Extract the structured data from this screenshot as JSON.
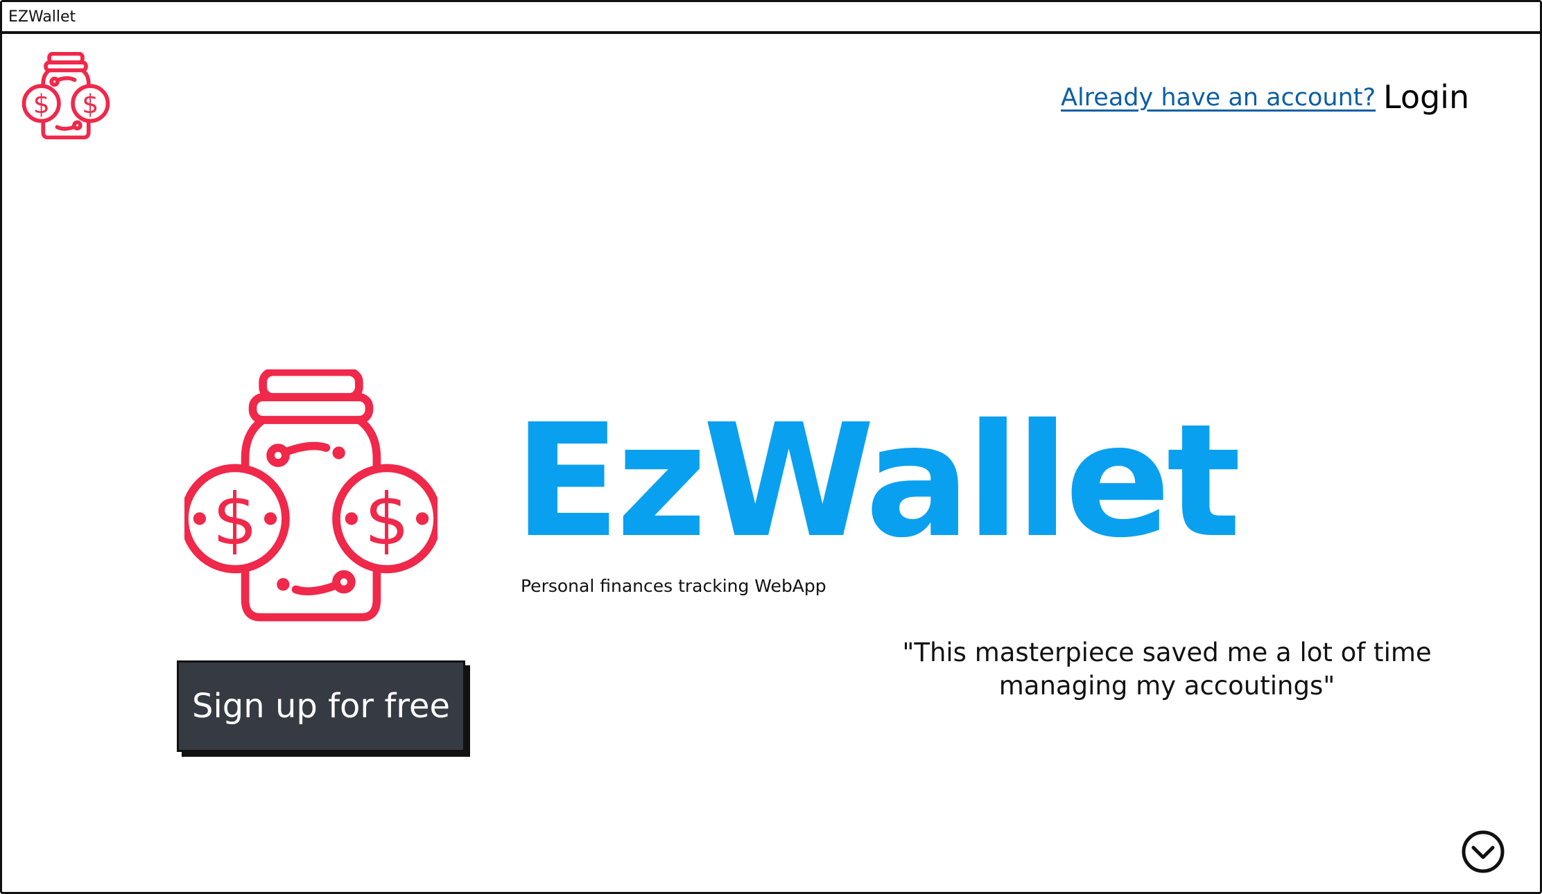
{
  "window": {
    "title": "EZWallet"
  },
  "header": {
    "logo_icon": "money-jar-icon",
    "already_link": "Already have an account?",
    "login_label": "Login"
  },
  "hero": {
    "logo_icon": "money-jar-icon",
    "brand_name": "EzWallet",
    "tagline": "Personal finances tracking WebApp",
    "signup_label": "Sign up for free",
    "testimonial": "\"This masterpiece saved me a lot of time managing my accoutings\""
  },
  "footer": {
    "scroll_icon": "chevron-down-circle-icon"
  },
  "colors": {
    "logo_red": "#f0284a",
    "brand_blue": "#0aa0f0",
    "link_blue": "#0b5fa5",
    "button_bg": "#353a43"
  }
}
